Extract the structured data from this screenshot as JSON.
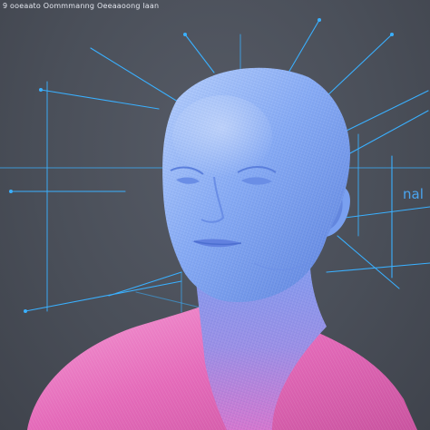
{
  "image": {
    "caption": "9 ooeaato Oommmanng Oeeaaoong laan",
    "side_label": "nal",
    "colors": {
      "background": "#474b56",
      "wire_lines": "#3ab0ff",
      "head": "#7aa6f5",
      "head_highlight": "#bcd4ff",
      "shoulders": "#e867b9",
      "shoulders_light": "#f7a0d6"
    }
  }
}
